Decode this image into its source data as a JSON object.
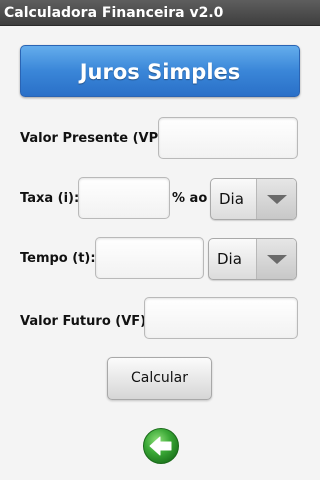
{
  "window": {
    "title": "Calculadora Financeira v2.0"
  },
  "header": {
    "title": "Juros Simples"
  },
  "form": {
    "vp_label": "Valor Presente (VP):",
    "vp_value": "",
    "taxa_label": "Taxa (i):",
    "taxa_value": "",
    "taxa_unit_label": "% ao",
    "taxa_period": "Dia",
    "tempo_label": "Tempo (t):",
    "tempo_value": "",
    "tempo_period": "Dia",
    "vf_label": "Valor Futuro (VF):",
    "vf_value": ""
  },
  "actions": {
    "calculate_label": "Calcular",
    "back_icon": "back-arrow-icon"
  },
  "colors": {
    "accent": "#3a86d8",
    "back_icon": "#2e9a2e",
    "titlebar": "#4a4a4a"
  }
}
